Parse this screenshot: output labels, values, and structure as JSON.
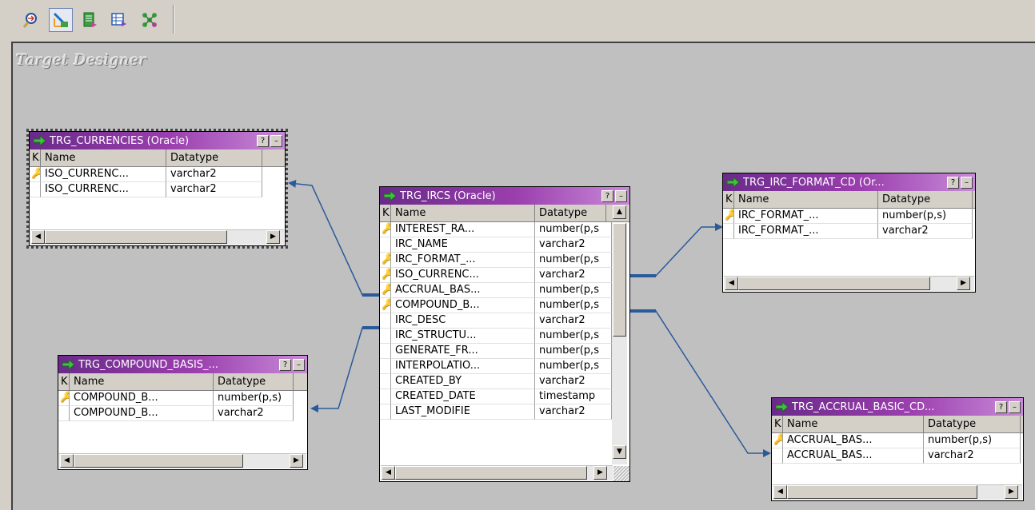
{
  "toolbar": {
    "buttons": [
      {
        "icon": "source-analyzer-icon"
      },
      {
        "icon": "target-designer-icon",
        "active": true
      },
      {
        "icon": "transformation-developer-icon"
      },
      {
        "icon": "mapplet-designer-icon"
      },
      {
        "icon": "mapping-designer-icon"
      }
    ]
  },
  "designer_title": "Target Designer",
  "columns": {
    "key": "K.",
    "name": "Name",
    "datatype": "Datatype"
  },
  "tables": {
    "currencies": {
      "title": "TRG_CURRENCIES (Oracle)",
      "rows": [
        {
          "key": true,
          "name": "ISO_CURRENC...",
          "datatype": "varchar2"
        },
        {
          "key": false,
          "name": "ISO_CURRENC...",
          "datatype": "varchar2"
        }
      ]
    },
    "compound_basis": {
      "title": "TRG_COMPOUND_BASIS_...",
      "rows": [
        {
          "key": true,
          "name": "COMPOUND_B...",
          "datatype": "number(p,s)"
        },
        {
          "key": false,
          "name": "COMPOUND_B...",
          "datatype": "varchar2"
        }
      ]
    },
    "ircs": {
      "title": "TRG_IRCS (Oracle)",
      "rows": [
        {
          "key": true,
          "name": "INTEREST_RA...",
          "datatype": "number(p,s"
        },
        {
          "key": false,
          "name": "IRC_NAME",
          "datatype": "varchar2"
        },
        {
          "key": true,
          "name": "IRC_FORMAT_...",
          "datatype": "number(p,s"
        },
        {
          "key": true,
          "name": "ISO_CURRENC...",
          "datatype": "varchar2"
        },
        {
          "key": true,
          "name": "ACCRUAL_BAS...",
          "datatype": "number(p,s"
        },
        {
          "key": true,
          "name": "COMPOUND_B...",
          "datatype": "number(p,s"
        },
        {
          "key": false,
          "name": "IRC_DESC",
          "datatype": "varchar2"
        },
        {
          "key": false,
          "name": "IRC_STRUCTU...",
          "datatype": "number(p,s"
        },
        {
          "key": false,
          "name": "GENERATE_FR...",
          "datatype": "number(p,s"
        },
        {
          "key": false,
          "name": "INTERPOLATIO...",
          "datatype": "number(p,s"
        },
        {
          "key": false,
          "name": "CREATED_BY",
          "datatype": "varchar2"
        },
        {
          "key": false,
          "name": "CREATED_DATE",
          "datatype": "timestamp"
        },
        {
          "key": false,
          "name": "LAST_MODIFIE",
          "datatype": "varchar2"
        }
      ]
    },
    "irc_format_cd": {
      "title": "TRG_IRC_FORMAT_CD (Or...",
      "rows": [
        {
          "key": true,
          "name": "IRC_FORMAT_...",
          "datatype": "number(p,s)"
        },
        {
          "key": false,
          "name": "IRC_FORMAT_...",
          "datatype": "varchar2"
        }
      ]
    },
    "accrual_basic_cd": {
      "title": "TRG_ACCRUAL_BASIC_CD...",
      "rows": [
        {
          "key": true,
          "name": "ACCRUAL_BAS...",
          "datatype": "number(p,s)"
        },
        {
          "key": false,
          "name": "ACCRUAL_BAS...",
          "datatype": "varchar2"
        }
      ]
    }
  },
  "colors": {
    "title_bar_start": "#6a2a8a",
    "title_bar_end": "#c88ad8",
    "link_line": "#2a5a9a",
    "canvas": "#c0c0c0"
  }
}
